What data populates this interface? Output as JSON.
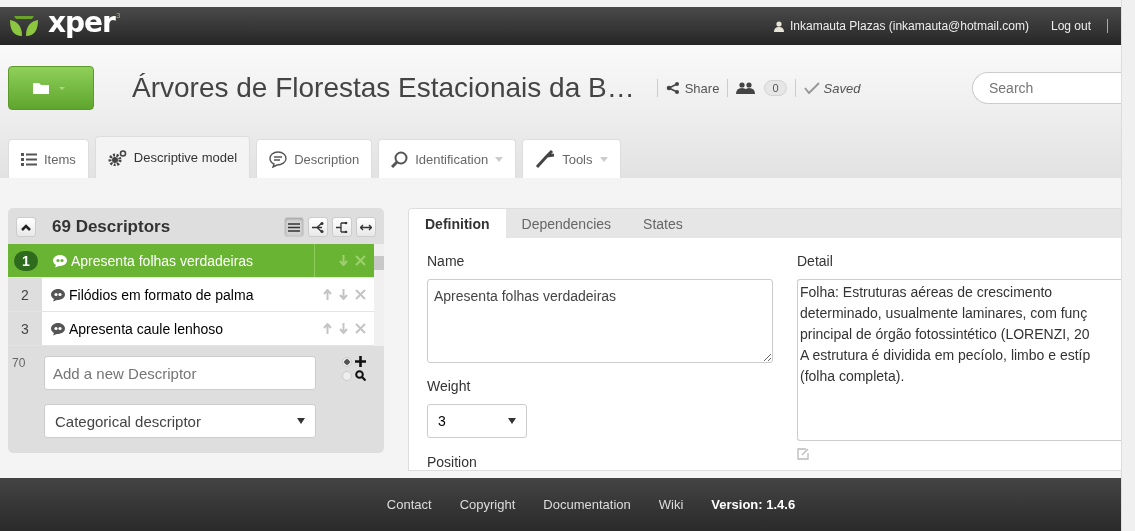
{
  "topbar": {
    "brand": "xper",
    "brand_mark": "3",
    "user": "Inkamauta Plazas (inkamauta@hotmail.com)",
    "logout": "Log out"
  },
  "header": {
    "title": "Árvores de Florestas Estacionais da B…",
    "share": "Share",
    "members": "0",
    "saved": "Saved",
    "search_placeholder": "Search"
  },
  "tabs": [
    {
      "label": "Items",
      "kind": "list",
      "selected": false,
      "dropdown": false
    },
    {
      "label": "Descriptive model",
      "kind": "gears",
      "selected": true,
      "dropdown": false
    },
    {
      "label": "Description",
      "kind": "bubble",
      "selected": false,
      "dropdown": false
    },
    {
      "label": "Identification",
      "kind": "magnifier",
      "selected": false,
      "dropdown": true
    },
    {
      "label": "Tools",
      "kind": "wrench",
      "selected": false,
      "dropdown": true
    }
  ],
  "descriptors": {
    "title": "69 Descriptors",
    "view_buttons": [
      {
        "kind": "list",
        "selected": true
      },
      {
        "kind": "tree",
        "selected": false
      },
      {
        "kind": "branch",
        "selected": false
      },
      {
        "kind": "expand",
        "selected": false
      }
    ],
    "rows": [
      {
        "number": "1",
        "name": "Apresenta folhas verdadeiras",
        "selected": true,
        "can_move_up": false
      },
      {
        "number": "2",
        "name": "Filódios em formato de palma",
        "selected": false,
        "can_move_up": true
      },
      {
        "number": "3",
        "name": "Apresenta caule lenhoso",
        "selected": false,
        "can_move_up": true
      }
    ],
    "next_number": "70",
    "new_placeholder": "Add a new Descriptor",
    "modes": [
      {
        "kind": "plus",
        "selected": true
      },
      {
        "kind": "search",
        "selected": false
      }
    ],
    "type": "Categorical descriptor"
  },
  "detail_tabs": [
    {
      "label": "Definition",
      "selected": true
    },
    {
      "label": "Dependencies",
      "selected": false
    },
    {
      "label": "States",
      "selected": false
    }
  ],
  "form": {
    "name_label": "Name",
    "name_value": "Apresenta folhas verdadeiras",
    "weight_label": "Weight",
    "weight_value": "3",
    "position_label": "Position",
    "detail_label": "Detail",
    "detail_lines": [
      "Folha: Estruturas aéreas de crescimento",
      "determinado, usualmente laminares, com funç",
      "principal de órgão fotossintético (LORENZI, 20",
      "A estrutura é dividida em pecíolo, limbo e estíp",
      "(folha completa)."
    ]
  },
  "footer": {
    "links": [
      "Contact",
      "Copyright",
      "Documentation",
      "Wiki"
    ],
    "version": "Version: 1.4.6"
  }
}
